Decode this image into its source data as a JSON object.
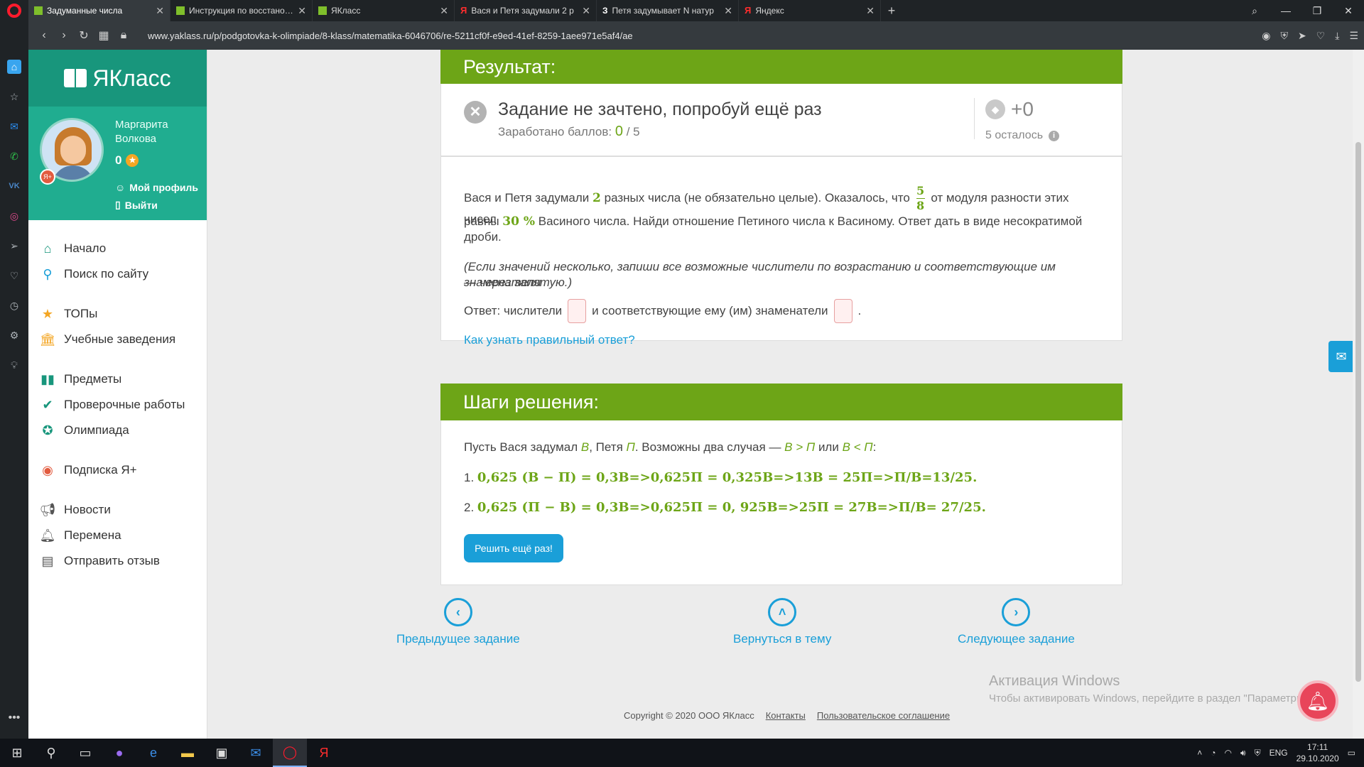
{
  "browser": {
    "tabs": [
      {
        "label": "Задуманные числа",
        "favicon": "yaklass",
        "active": true
      },
      {
        "label": "Инструкция по восстановлению",
        "favicon": "yaklass",
        "active": false
      },
      {
        "label": "ЯКласс",
        "favicon": "yaklass",
        "active": false
      },
      {
        "label": "Вася и Петя задумали 2 р",
        "favicon": "yandex",
        "active": false
      },
      {
        "label": "Петя задумывает N натур",
        "favicon": "znanija",
        "active": false
      },
      {
        "label": "Яндекс",
        "favicon": "yandex",
        "active": false
      }
    ],
    "url": "www.yaklass.ru/p/podgotovka-k-olimpiade/8-klass/matematika-6046706/re-5211cf0f-e9ed-41ef-8259-1aee971e5af4/ae"
  },
  "site": {
    "logo": "ЯКласс",
    "user": {
      "name": "Маргарита Волкова",
      "score": "0",
      "badge": "Я+",
      "profile_link": "Мой профиль",
      "logout_link": "Выйти"
    },
    "menu": [
      {
        "label": "Начало",
        "icon": "home-icon",
        "color": "#18967c"
      },
      {
        "label": "Поиск по сайту",
        "icon": "search-icon",
        "color": "#1a9fd8"
      },
      {
        "label": "ТОПы",
        "icon": "star-icon",
        "color": "#f4a623"
      },
      {
        "label": "Учебные заведения",
        "icon": "school-icon",
        "color": "#f4a623"
      },
      {
        "label": "Предметы",
        "icon": "books-icon",
        "color": "#18967c"
      },
      {
        "label": "Проверочные работы",
        "icon": "check-icon",
        "color": "#18967c"
      },
      {
        "label": "Олимпиада",
        "icon": "medal-icon",
        "color": "#18967c"
      },
      {
        "label": "Подписка Я+",
        "icon": "subscription-icon",
        "color": "#e25b3f"
      },
      {
        "label": "Новости",
        "icon": "megaphone-icon",
        "color": "#555555"
      },
      {
        "label": "Перемена",
        "icon": "bell-icon",
        "color": "#555555"
      },
      {
        "label": "Отправить отзыв",
        "icon": "feedback-icon",
        "color": "#555555"
      }
    ]
  },
  "result": {
    "header": "Результат:",
    "title": "Задание не зачтено, попробуй ещё раз",
    "earned_label": "Заработано баллов:",
    "earned": "0",
    "total": "/ 5",
    "points": "+0",
    "remaining": "5 осталось"
  },
  "task": {
    "p1_a": "Вася и Петя задумали",
    "p1_n": "2",
    "p1_b": "разных числа (не обязательно целые). Оказалось, что",
    "frac_num": "5",
    "frac_den": "8",
    "p1_c": "от модуля разности этих чисел",
    "p2_a": "равны",
    "p2_pct": "30 %",
    "p2_b": "Васиного числа. Найди отношение Петиного числа к Васиному. Ответ дать в виде несократимой",
    "p3": "дроби.",
    "note1": "(Если значений несколько, запиши все возможные числители по возрастанию и соответствующие им знаменатели",
    "note2": "— через запятую.)",
    "ans_a": "Ответ: числители",
    "ans_b": "и соответствующие ему (им) знаменатели",
    "ans_c": ".",
    "how_link": "Как узнать правильный ответ?"
  },
  "steps": {
    "header": "Шаги решения:",
    "intro_a": "Пусть Вася задумал",
    "intro_v": "В",
    "intro_b": ", Петя",
    "intro_p": "П",
    "intro_c": ". Возможны два случая —",
    "intro_case1": "В > П",
    "intro_or": "или",
    "intro_case2": "В < П",
    "intro_d": ":",
    "line1_n": "1.",
    "line1": "0,625 (В − П) = 0,3В=>0,625П = 0,325В=>13В = 25П=>П/В=13/25.",
    "line2_n": "2.",
    "line2": "0,625 (П − В)  =  0,3В=>0,625П = 0, 925В=>25П = 27В=>П/В= 27/25.",
    "retry_button": "Решить ещё раз!"
  },
  "bottom_nav": {
    "prev": "Предыдущее задание",
    "back": "Вернуться в тему",
    "next": "Следующее задание"
  },
  "windows_activation": {
    "title": "Активация Windows",
    "text": "Чтобы активировать Windows, перейдите в раздел \"Параметры\""
  },
  "footer": {
    "copyright": "Copyright © 2020 ООО ЯКласс",
    "contacts": "Контакты",
    "agreement": "Пользовательское соглашение"
  },
  "taskbar": {
    "lang": "ENG",
    "time": "17:11",
    "date": "29.10.2020"
  }
}
